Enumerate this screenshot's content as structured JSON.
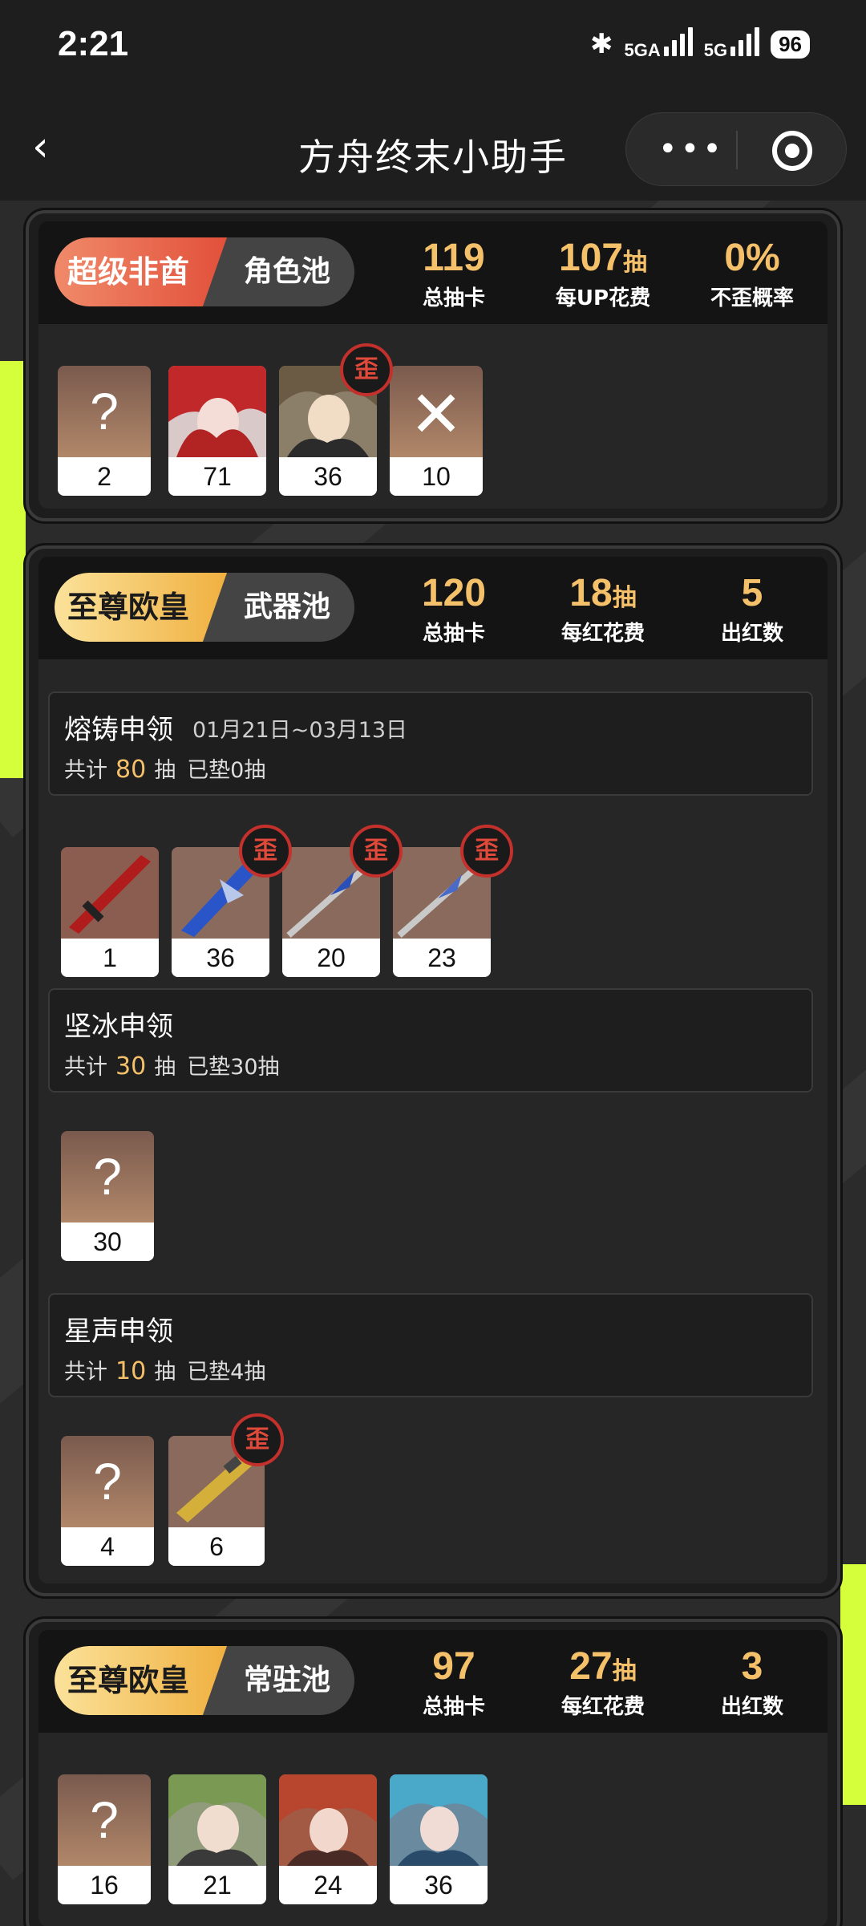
{
  "status_bar": {
    "time": "2:21",
    "signal1": "5GA",
    "signal2": "5G",
    "battery": "96",
    "bluetooth_icon": "bluetooth-icon"
  },
  "nav": {
    "title": "方舟终末小助手",
    "back_icon": "chevron-left-icon",
    "more_icon": "more-dots-icon",
    "close_icon": "target-circle-icon"
  },
  "colors": {
    "accent_gold": "#f5c06a",
    "badge_red": "#e2503a",
    "badge_gold": "#f0b040",
    "tag_red": "#c4302b",
    "lime": "#d4ff3a"
  },
  "character_pool": {
    "badge_title": "超级非酋",
    "pool_name": "角色池",
    "stats": [
      {
        "value": "119",
        "unit": "",
        "label": "总抽卡"
      },
      {
        "value": "107",
        "unit": "抽",
        "label": "每UP花费"
      },
      {
        "value": "0%",
        "unit": "",
        "label": "不歪概率"
      }
    ],
    "items": [
      {
        "count": "2",
        "kind": "unknown"
      },
      {
        "count": "71",
        "kind": "character",
        "off_banner": false
      },
      {
        "count": "36",
        "kind": "character",
        "off_banner": true,
        "tag": "歪"
      },
      {
        "count": "10",
        "kind": "none"
      }
    ]
  },
  "weapon_pool": {
    "badge_title": "至尊欧皇",
    "pool_name": "武器池",
    "stats": [
      {
        "value": "120",
        "unit": "",
        "label": "总抽卡"
      },
      {
        "value": "18",
        "unit": "抽",
        "label": "每红花费"
      },
      {
        "value": "5",
        "unit": "",
        "label": "出红数"
      }
    ],
    "banners": [
      {
        "name": "熔铸申领",
        "date": "01月21日~03月13日",
        "total_prefix": "共计",
        "total": "80",
        "total_suffix": "抽",
        "pity": "已垫0抽",
        "items": [
          {
            "count": "1",
            "tag": ""
          },
          {
            "count": "36",
            "tag": "歪"
          },
          {
            "count": "20",
            "tag": "歪"
          },
          {
            "count": "23",
            "tag": "歪"
          }
        ]
      },
      {
        "name": "坚冰申领",
        "date": "",
        "total_prefix": "共计",
        "total": "30",
        "total_suffix": "抽",
        "pity": "已垫30抽",
        "items": [
          {
            "count": "30",
            "tag": "",
            "kind": "unknown"
          }
        ]
      },
      {
        "name": "星声申领",
        "date": "",
        "total_prefix": "共计",
        "total": "10",
        "total_suffix": "抽",
        "pity": "已垫4抽",
        "items": [
          {
            "count": "4",
            "tag": "",
            "kind": "unknown"
          },
          {
            "count": "6",
            "tag": "歪"
          }
        ]
      }
    ]
  },
  "standard_pool": {
    "badge_title": "至尊欧皇",
    "pool_name": "常驻池",
    "stats": [
      {
        "value": "97",
        "unit": "",
        "label": "总抽卡"
      },
      {
        "value": "27",
        "unit": "抽",
        "label": "每红花费"
      },
      {
        "value": "3",
        "unit": "",
        "label": "出红数"
      }
    ],
    "items": [
      {
        "count": "16",
        "kind": "unknown"
      },
      {
        "count": "21",
        "kind": "character"
      },
      {
        "count": "24",
        "kind": "character"
      },
      {
        "count": "36",
        "kind": "character"
      }
    ]
  },
  "symbols": {
    "unknown": "?",
    "none": "✕"
  }
}
